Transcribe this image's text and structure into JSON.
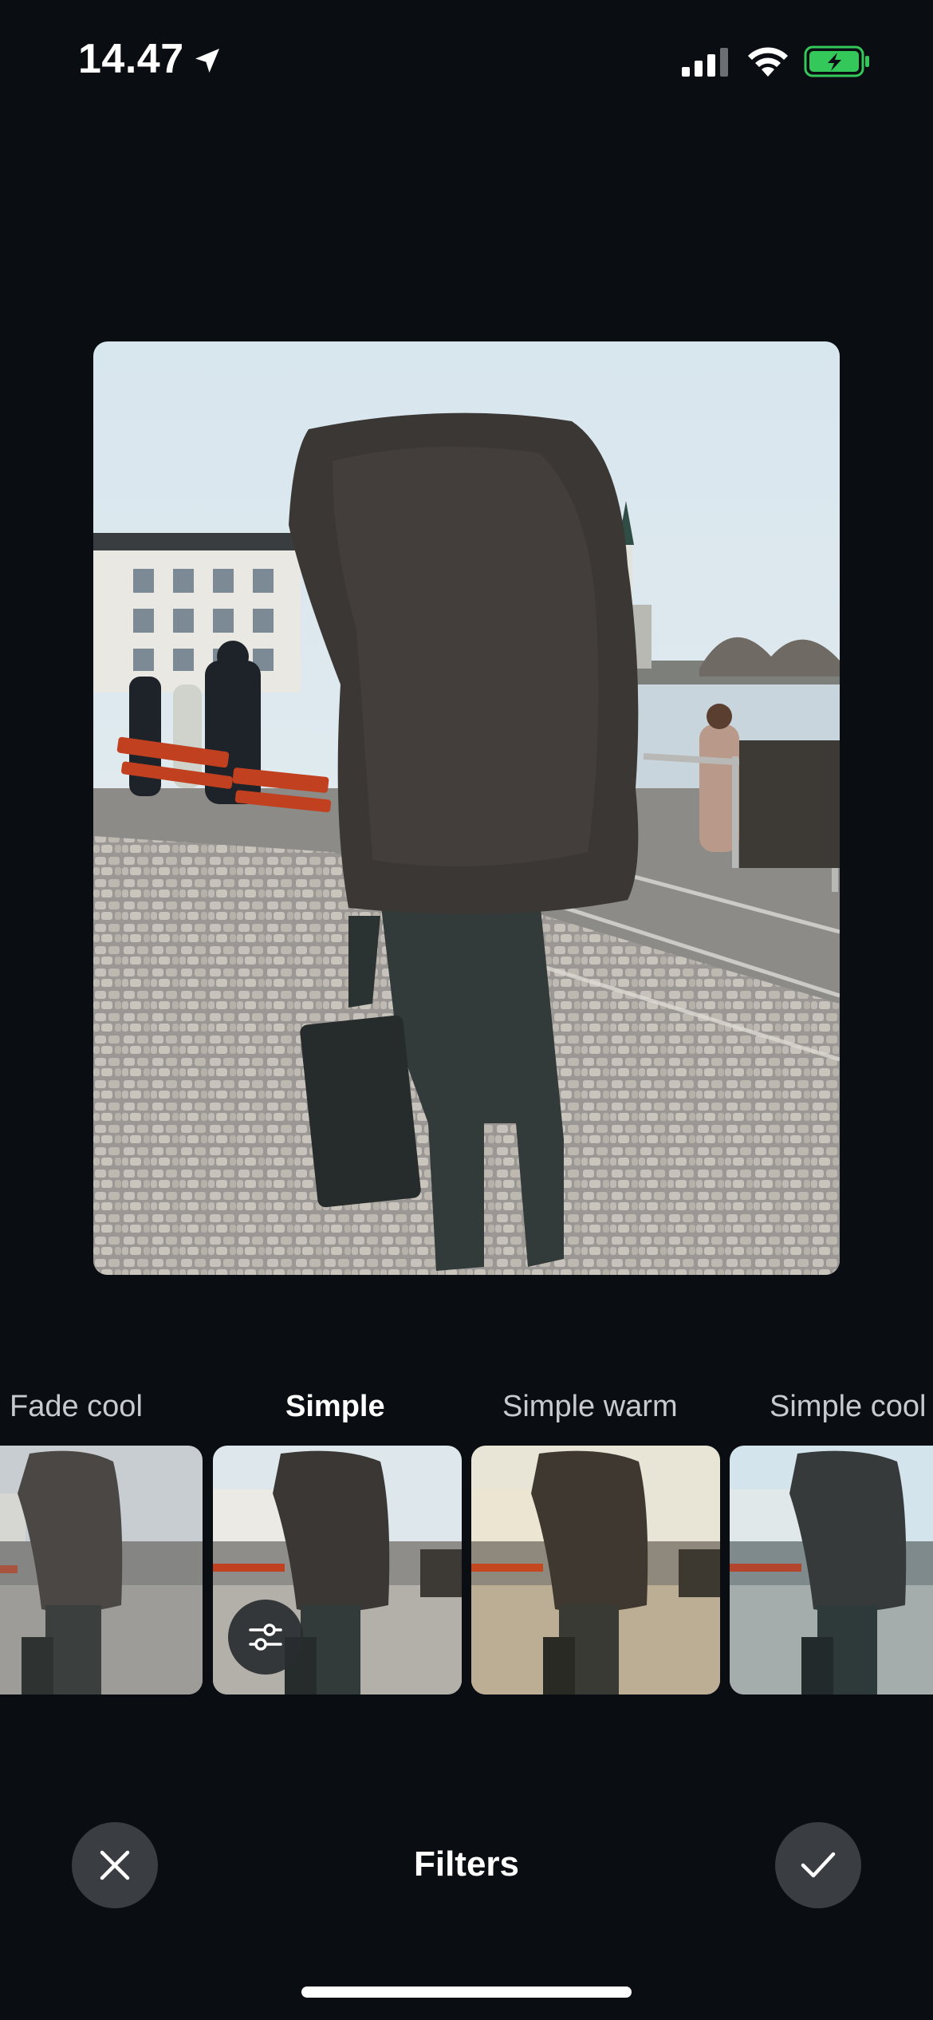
{
  "status_bar": {
    "time": "14.47",
    "icons": [
      "location-arrow-icon",
      "cellular-signal-icon",
      "wifi-icon",
      "battery-charging-icon"
    ],
    "battery_color": "#34c759"
  },
  "editor": {
    "title": "Filters",
    "cancel_icon": "close-icon",
    "confirm_icon": "checkmark-icon",
    "adjust_icon": "sliders-icon"
  },
  "filters": [
    {
      "label": "Fade cool",
      "selected": false
    },
    {
      "label": "Simple",
      "selected": true
    },
    {
      "label": "Simple warm",
      "selected": false
    },
    {
      "label": "Simple cool",
      "selected": false
    }
  ],
  "colors": {
    "background": "#0a0e12",
    "button_bg": "#3a3d42",
    "label_inactive": "#c8cace",
    "label_active": "#ffffff"
  }
}
